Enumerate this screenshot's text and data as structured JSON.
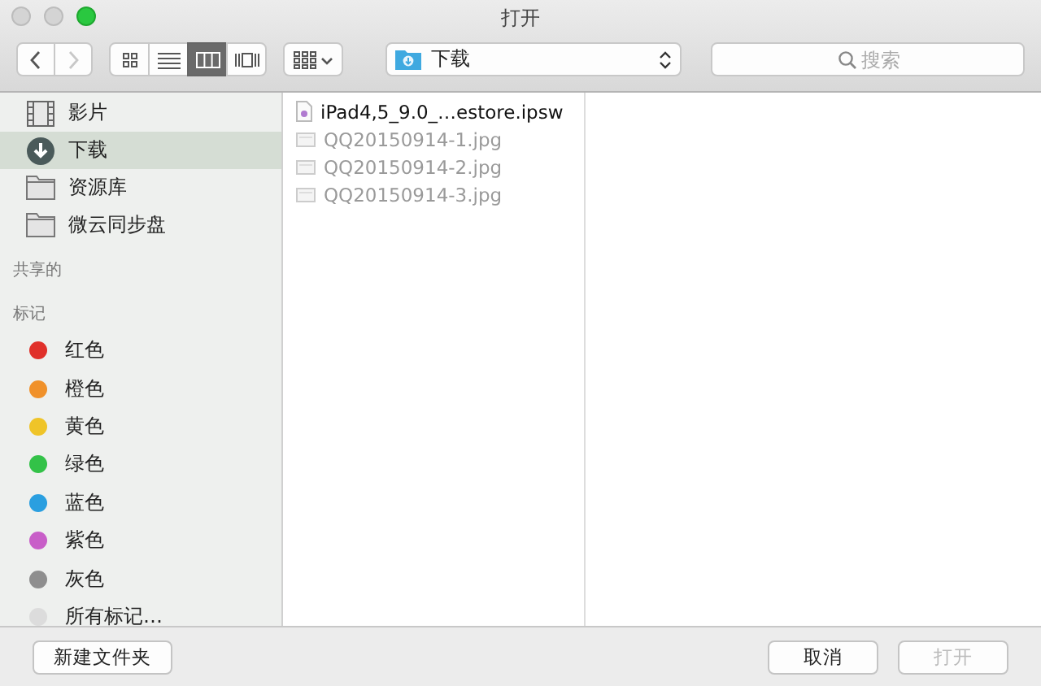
{
  "window": {
    "title": "打开"
  },
  "toolbar": {
    "nav": [
      {
        "kind": "back",
        "disabled": false
      },
      {
        "kind": "forward",
        "disabled": true
      }
    ],
    "views": [
      {
        "kind": "icons",
        "selected": false
      },
      {
        "kind": "list",
        "selected": false
      },
      {
        "kind": "columns",
        "selected": true
      },
      {
        "kind": "coverflow",
        "selected": false
      }
    ],
    "location": "下载",
    "search": {
      "placeholder": "搜索"
    }
  },
  "sidebar": {
    "items": [
      {
        "label": "影片",
        "kind": "movies",
        "selected": false
      },
      {
        "label": "下载",
        "kind": "downloads",
        "selected": true
      },
      {
        "label": "资源库",
        "kind": "folder",
        "selected": false
      },
      {
        "label": "微云同步盘",
        "kind": "folder",
        "selected": false
      }
    ],
    "sections": [
      "共享的",
      "标记"
    ],
    "tags": [
      {
        "label": "红色",
        "color": "#e0302a"
      },
      {
        "label": "橙色",
        "color": "#f0912a"
      },
      {
        "label": "黄色",
        "color": "#efc428"
      },
      {
        "label": "绿色",
        "color": "#33c248"
      },
      {
        "label": "蓝色",
        "color": "#2a9fe0"
      },
      {
        "label": "紫色",
        "color": "#c85ec8"
      },
      {
        "label": "灰色",
        "color": "#8e8e8e"
      },
      {
        "label": "所有标记…",
        "color": "#dcdcdc"
      }
    ]
  },
  "files": [
    {
      "name": "iPad4,5_9.0_…estore.ipsw",
      "disabled": false
    },
    {
      "name": "QQ20150914-1.jpg",
      "disabled": true
    },
    {
      "name": "QQ20150914-2.jpg",
      "disabled": true
    },
    {
      "name": "QQ20150914-3.jpg",
      "disabled": true
    }
  ],
  "buttons": [
    {
      "label": "新建文件夹",
      "disabled": false
    },
    {
      "label": "取消",
      "disabled": false
    },
    {
      "label": "打开",
      "disabled": true
    }
  ]
}
